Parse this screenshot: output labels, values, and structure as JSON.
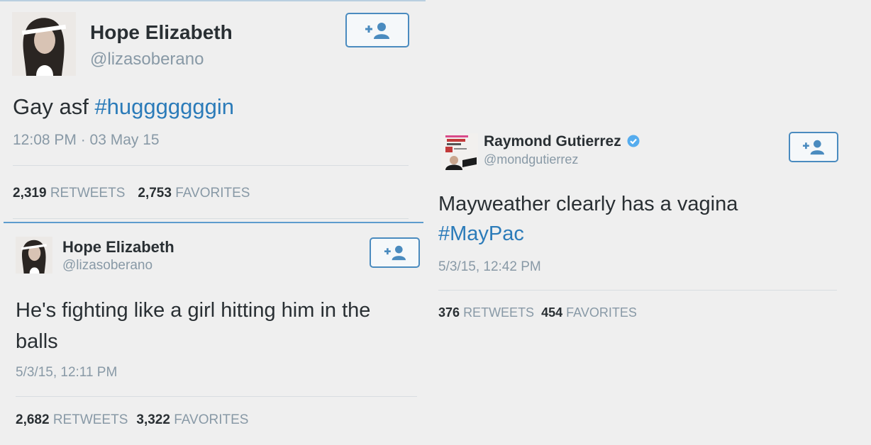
{
  "tweets": [
    {
      "name": "Hope Elizabeth",
      "handle": "@lizasoberano",
      "text": "Gay asf ",
      "hashtag": "#hugggggggin",
      "time": "12:08 PM · 03 May 15",
      "retweets_count": "2,319",
      "retweets_label": "RETWEETS",
      "favorites_count": "2,753",
      "favorites_label": "FAVORITES",
      "follow_icon": "follow-user-icon"
    },
    {
      "name": "Hope Elizabeth",
      "handle": "@lizasoberano",
      "text_line1": "He's fighting like a girl hitting him in the",
      "text_line2": "balls",
      "time": "5/3/15, 12:11 PM",
      "retweets_count": "2,682",
      "retweets_label": "RETWEETS",
      "favorites_count": "3,322",
      "favorites_label": "FAVORITES",
      "follow_icon": "follow-user-icon"
    },
    {
      "name": "Raymond Gutierrez",
      "handle": "@mondgutierrez",
      "verified_icon": "verified-badge-icon",
      "text_line1": "Mayweather clearly has a vagina",
      "hashtag": "#MayPac",
      "time": "5/3/15, 12:42 PM",
      "retweets_count": "376",
      "retweets_label": "RETWEETS",
      "favorites_count": "454",
      "favorites_label": "FAVORITES",
      "follow_icon": "follow-user-icon"
    }
  ],
  "colors": {
    "background": "#efefef",
    "hashtag": "#2b7bb9",
    "follow_border": "#4a8bbf",
    "secondary_text": "#8899a6",
    "verified": "#55acee"
  }
}
